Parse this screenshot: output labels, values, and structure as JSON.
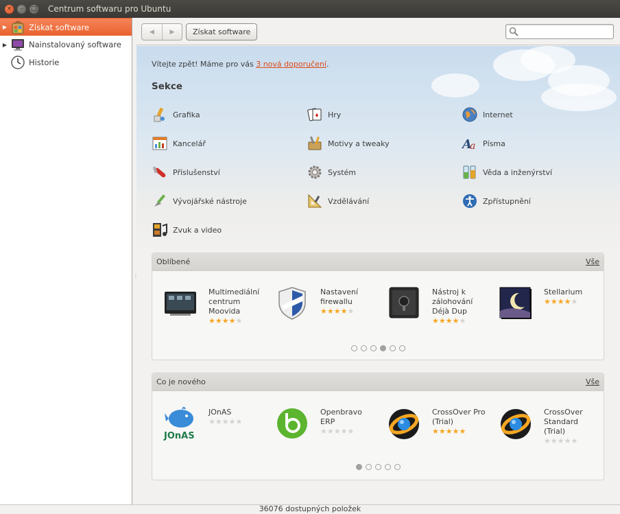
{
  "window": {
    "title": "Centrum softwaru pro Ubuntu",
    "close_glyph": "×",
    "minimize_glyph": "–",
    "maximize_glyph": "□"
  },
  "sidebar": {
    "items": [
      {
        "label": "Získat software",
        "icon": "software-center-icon",
        "selected": true,
        "expander": "▶"
      },
      {
        "label": "Nainstalovaný software",
        "icon": "monitor-icon",
        "selected": false,
        "expander": "▶"
      },
      {
        "label": "Historie",
        "icon": "clock-icon",
        "selected": false,
        "expander": ""
      }
    ]
  },
  "toolbar": {
    "back_glyph": "◀",
    "forward_glyph": "▶",
    "breadcrumb": "Získat software",
    "search_value": ""
  },
  "main": {
    "welcome_text": "Vítejte zpět! Máme pro vás ",
    "welcome_link": "3 nová doporučení",
    "welcome_end": ".",
    "sections_title": "Sekce",
    "categories": [
      {
        "label": "Grafika",
        "icon": "graphics-icon"
      },
      {
        "label": "Hry",
        "icon": "games-icon"
      },
      {
        "label": "Internet",
        "icon": "internet-globe-icon"
      },
      {
        "label": "Kancelář",
        "icon": "office-icon"
      },
      {
        "label": "Motivy a tweaky",
        "icon": "themes-tweaks-icon"
      },
      {
        "label": "Písma",
        "icon": "fonts-icon"
      },
      {
        "label": "Příslušenství",
        "icon": "accessories-icon"
      },
      {
        "label": "Systém",
        "icon": "system-gear-icon"
      },
      {
        "label": "Věda a inženýrství",
        "icon": "science-icon"
      },
      {
        "label": "Vývojářské nástroje",
        "icon": "developer-tools-icon"
      },
      {
        "label": "Vzdělávání",
        "icon": "education-icon"
      },
      {
        "label": "Zpřístupnění",
        "icon": "accessibility-icon"
      },
      {
        "label": "Zvuk a video",
        "icon": "sound-video-icon"
      }
    ],
    "featured": {
      "title": "Oblíbené",
      "all_label": "Vše",
      "apps": [
        {
          "name": "Multimediální centrum Moovida",
          "rating": 4.5,
          "stars": "★★★★",
          "stars_off": "★",
          "icon": "moovida-icon"
        },
        {
          "name": "Nastavení firewallu",
          "rating": 4.5,
          "stars": "★★★★",
          "stars_off": "★",
          "icon": "firewall-shield-icon"
        },
        {
          "name": "Nástroj k zálohování Déjà Dup",
          "rating": 4.5,
          "stars": "★★★★",
          "stars_off": "★",
          "icon": "safe-icon"
        },
        {
          "name": "Stellarium",
          "rating": 4.5,
          "stars": "★★★★",
          "stars_off": "★",
          "icon": "stellarium-icon"
        }
      ],
      "pages": 6,
      "active_page": 4
    },
    "whats_new": {
      "title": "Co je nového",
      "all_label": "Vše",
      "apps": [
        {
          "name": "JOnAS",
          "rating": 0,
          "stars": "",
          "stars_off": "★★★★★",
          "icon": "jonas-whale-icon"
        },
        {
          "name": "Openbravo ERP",
          "rating": 0,
          "stars": "",
          "stars_off": "★★★★★",
          "icon": "openbravo-icon"
        },
        {
          "name": "CrossOver Pro (Trial)",
          "rating": 5,
          "stars": "★★★★★",
          "stars_off": "",
          "icon": "crossover-icon"
        },
        {
          "name": "CrossOver Standard (Trial)",
          "rating": 0,
          "stars": "",
          "stars_off": "★★★★★",
          "icon": "crossover-standard-icon"
        }
      ],
      "pages": 5,
      "active_page": 1
    }
  },
  "status": {
    "text": "36076 dostupných položek"
  },
  "colors": {
    "accent": "#e9622f",
    "link": "#dd4814",
    "star": "#f5a623",
    "titlebar": "#3c3b37"
  }
}
